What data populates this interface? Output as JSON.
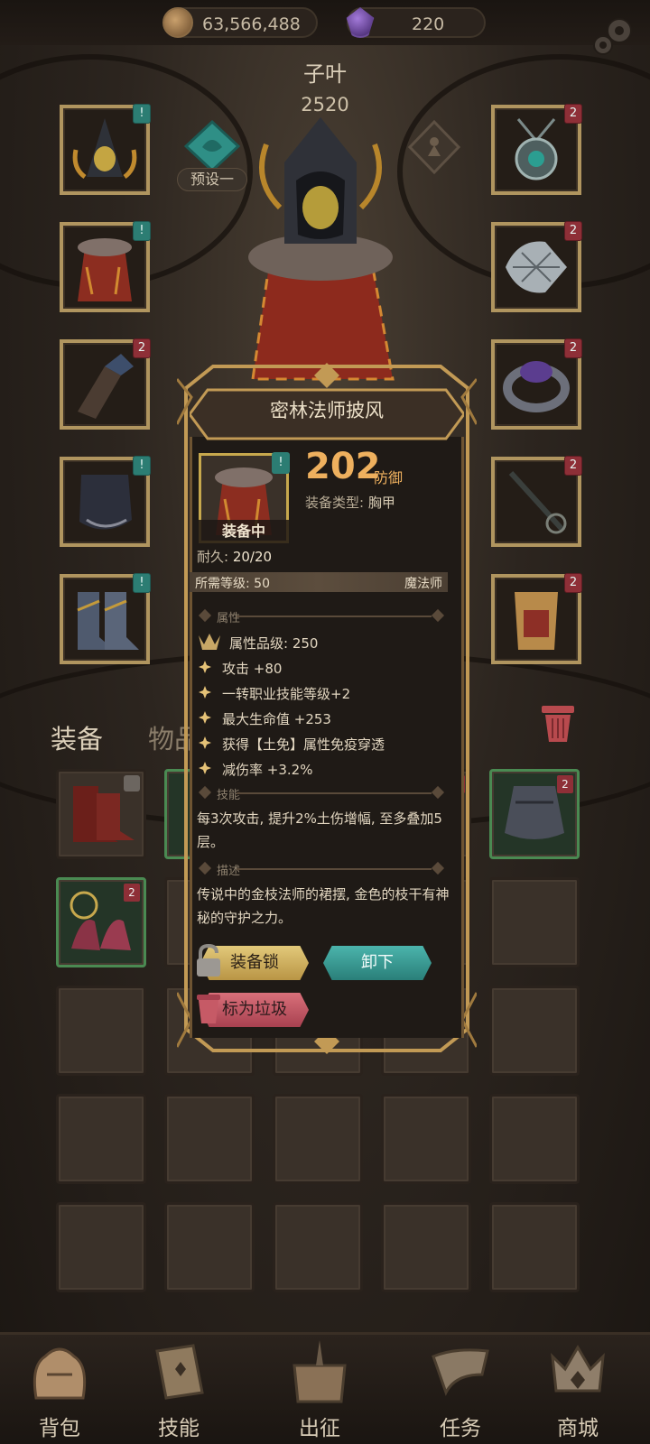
{
  "currency": {
    "gold": "63,566,488",
    "gems": "220"
  },
  "character": {
    "name": "子叶",
    "power": "2520",
    "preset_label": "预设一"
  },
  "slots": {
    "left": [
      {
        "tag": "!"
      },
      {
        "tag": "!"
      },
      {
        "tag": "2"
      },
      {
        "tag": "!"
      },
      {
        "tag": "!"
      }
    ],
    "right": [
      {
        "tag": "2"
      },
      {
        "tag": "2"
      },
      {
        "tag": "2"
      },
      {
        "tag": "2"
      },
      {
        "tag": "2"
      }
    ]
  },
  "tabs": {
    "equipment": "装备",
    "items": "物品"
  },
  "inventory": [
    {
      "locked": true
    },
    {
      "tag": ""
    },
    {
      "tag": ""
    },
    {
      "tag": ""
    },
    {
      "tag": "2"
    },
    {
      "tag": "2"
    }
  ],
  "tooltip": {
    "title": "密林法师披风",
    "stat_value": "202",
    "stat_unit": "防御",
    "equip_type_key": "装备类型:",
    "equip_type_value": "胸甲",
    "equipped_label": "装备中",
    "durability_key": "耐久:",
    "durability_value": "20/20",
    "req_level": "所需等级: 50",
    "req_class": "魔法师",
    "section_attr": "属性",
    "attr_grade": "属性品级: 250",
    "attributes": [
      "攻击 +80",
      "一转职业技能等级+2",
      "最大生命值 +253",
      "获得【土免】属性免疫穿透",
      "减伤率 +3.2%"
    ],
    "section_skill": "技能",
    "skill_text": "每3次攻击, 提升2%土伤增幅, 至多叠加5层。",
    "section_desc": "描述",
    "desc_text": "传说中的金枝法师的裙摆, 金色的枝干有神秘的守护之力。",
    "lock_button": "装备锁",
    "unequip_button": "卸下",
    "junk_button": "标为垃圾"
  },
  "nav": [
    "背包",
    "技能",
    "出征",
    "任务",
    "商城"
  ]
}
